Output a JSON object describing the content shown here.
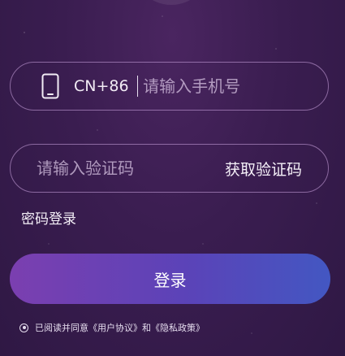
{
  "phone": {
    "country_code": "CN+86",
    "placeholder": "请输入手机号",
    "icon": "smartphone-icon"
  },
  "code": {
    "placeholder": "请输入验证码",
    "get_code_label": "获取验证码"
  },
  "password_login_label": "密码登录",
  "login_button_label": "登录",
  "agreement": {
    "checked": true,
    "prefix": "已阅读并同意",
    "user_agreement": "《用户协议》",
    "and": "和",
    "privacy_policy": "《隐私政策》"
  },
  "colors": {
    "background": "#3a1d50",
    "button_gradient_start": "#7b3fb0",
    "button_gradient_end": "#4357c2",
    "field_border": "#d2aae6"
  }
}
